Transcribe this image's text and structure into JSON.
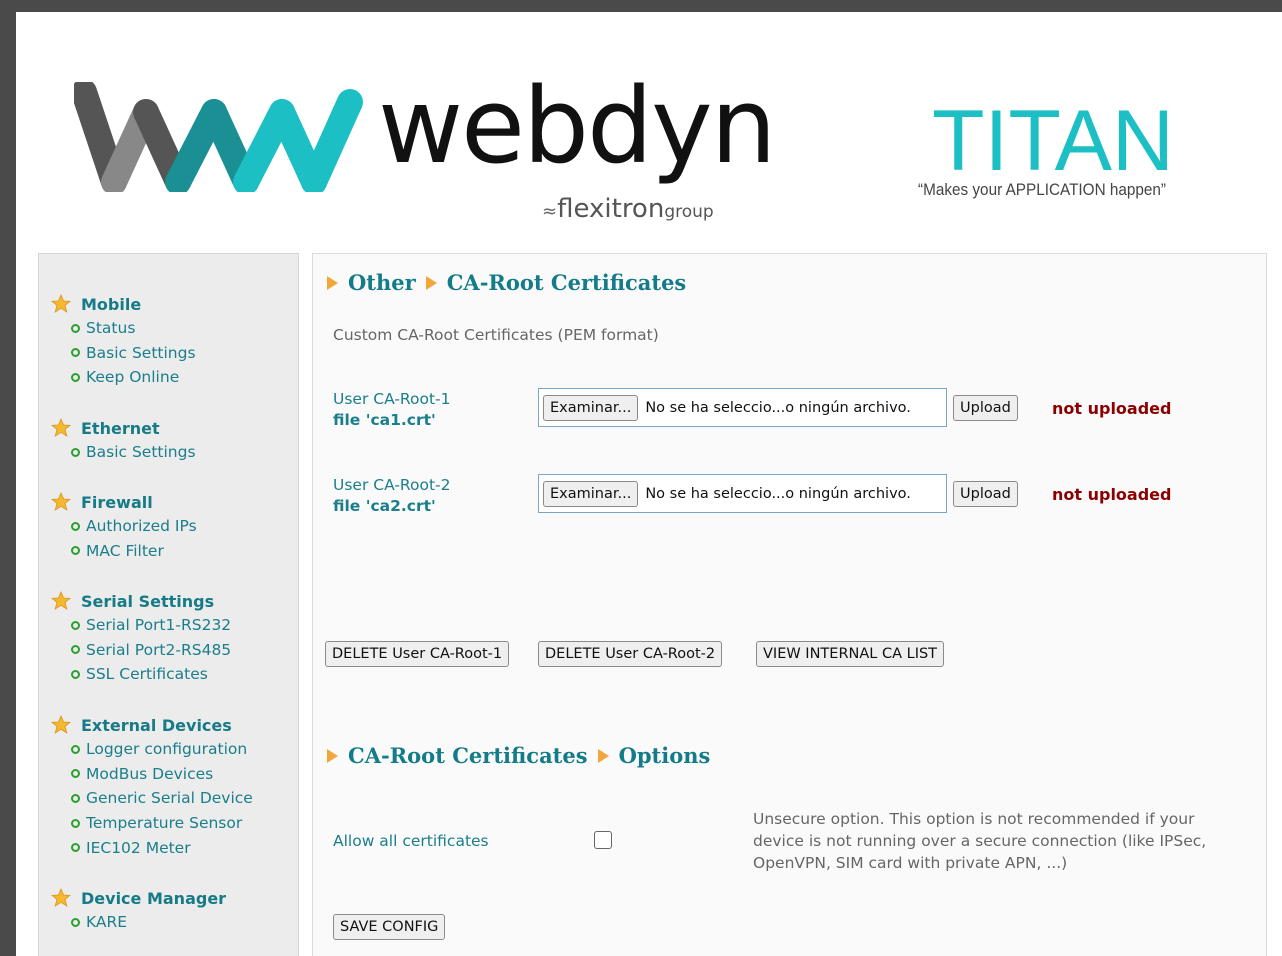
{
  "header": {
    "logo_word": "webdyn",
    "logo_group_name": "flexitron",
    "logo_group_suffix": "group",
    "product": "TITAN",
    "tagline": "“Makes your APPLICATION happen”"
  },
  "colors": {
    "accent": "#1cbfc3",
    "teal_text": "#147c88",
    "status_red": "#8b0000",
    "arrow_orange": "#f2a73c",
    "bullet_green": "#2e9e33"
  },
  "sidebar": [
    {
      "title": "Mobile",
      "items": [
        "Status",
        "Basic Settings",
        "Keep Online"
      ]
    },
    {
      "title": "Ethernet",
      "items": [
        "Basic Settings"
      ]
    },
    {
      "title": "Firewall",
      "items": [
        "Authorized IPs",
        "MAC Filter"
      ]
    },
    {
      "title": "Serial Settings",
      "items": [
        "Serial Port1-RS232",
        "Serial Port2-RS485",
        "SSL Certificates"
      ]
    },
    {
      "title": "External Devices",
      "items": [
        "Logger configuration",
        "ModBus Devices",
        "Generic Serial Device",
        "Temperature Sensor",
        "IEC102 Meter"
      ]
    },
    {
      "title": "Device Manager",
      "items": [
        "KARE"
      ]
    }
  ],
  "main": {
    "section1": {
      "crumb1": "Other",
      "crumb2": "CA-Root Certificates"
    },
    "intro": "Custom CA-Root Certificates (PEM format)",
    "certs": [
      {
        "label": "User CA-Root-1",
        "file": "file 'ca1.crt'",
        "browse": "Examinar...",
        "file_name": "No se ha seleccio...o ningún archivo.",
        "upload": "Upload",
        "status": "not uploaded"
      },
      {
        "label": "User CA-Root-2",
        "file": "file 'ca2.crt'",
        "browse": "Examinar...",
        "file_name": "No se ha seleccio...o ningún archivo.",
        "upload": "Upload",
        "status": "not uploaded"
      }
    ],
    "actions": {
      "delete1": "DELETE User CA-Root-1",
      "delete2": "DELETE User CA-Root-2",
      "view_list": "VIEW INTERNAL CA LIST"
    },
    "section2": {
      "crumb1": "CA-Root Certificates",
      "crumb2": "Options"
    },
    "allow_label": "Allow all certificates",
    "allow_checked": false,
    "unsecure_note": "Unsecure option. This option is not recommended if your device is not running over a secure connection (like IPSec, OpenVPN, SIM card with private APN, ...)",
    "save": "SAVE CONFIG"
  }
}
